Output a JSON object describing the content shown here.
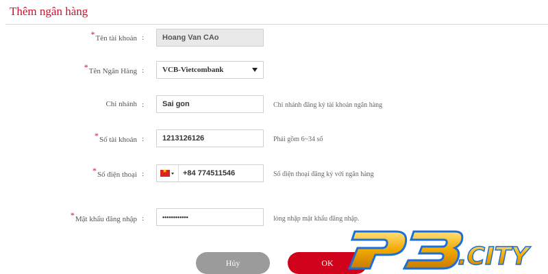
{
  "page": {
    "title": "Thêm ngân hàng"
  },
  "form": {
    "required_mark": "*",
    "colon": ":",
    "account_name": {
      "label": "Tên tài khoản",
      "value": "Hoang Van CAo",
      "required": true
    },
    "bank_name": {
      "label": "Tên Ngân Hàng",
      "value": "VCB-Vietcombank",
      "required": true
    },
    "branch": {
      "label": "Chi nhánh",
      "value": "Sai gon",
      "hint": "Chi nhánh đăng ký tài khoản ngân hàng",
      "required": false
    },
    "account_number": {
      "label": "Số tài khoản",
      "value": "1213126126",
      "hint": "Phải gồm 6~34 số",
      "required": true
    },
    "phone": {
      "label": "Số điện thoại",
      "value": "+84 774511546",
      "hint": "Số điện thoại đăng ký với ngân hàng",
      "required": true,
      "flag_icon": "vietnam-flag-icon"
    },
    "password": {
      "label": "Mật khẩu đăng nhập",
      "value": "••••••••••••",
      "hint": "lòng nhập mật khẩu đăng nhập.",
      "required": true
    }
  },
  "buttons": {
    "cancel": "Hủy",
    "ok": "OK"
  },
  "watermark": {
    "text": "P3.CITY"
  },
  "colors": {
    "accent": "#c8102e",
    "ok_button": "#d0021b",
    "cancel_button": "#9b9b9b",
    "logo_gold": "#f2a900",
    "logo_blue": "#1b6fd6"
  }
}
